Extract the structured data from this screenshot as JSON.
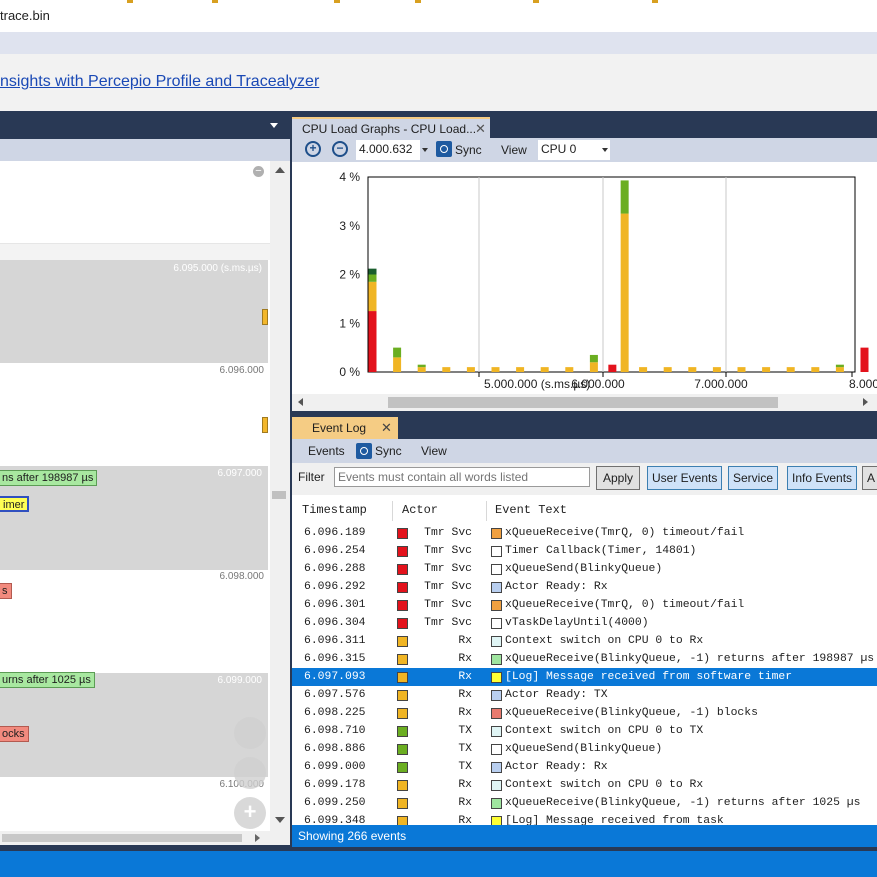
{
  "window": {
    "title": "trace.bin"
  },
  "banner": {
    "link_text": "nsights with Percepio Profile and Tracealyzer"
  },
  "left_panel": {
    "timeline": {
      "time_labels": [
        "6.095.000 (s.ms.µs)",
        "6.096.000",
        "6.097.000",
        "6.098.000",
        "6.099.000",
        "6.100.000"
      ],
      "events": [
        "ns after 198987 µs",
        "imer",
        "s",
        "urns after 1025 µs",
        "ocks"
      ]
    },
    "collapse_symbol": "−",
    "add_symbol": "+"
  },
  "cpu_panel": {
    "tab_label": "CPU Load Graphs - CPU Load...",
    "close_symbol": "✕",
    "zoom_in_symbol": "+",
    "zoom_out_symbol": "−",
    "zoom_value": "4.000.632",
    "sync_label": "Sync",
    "view_label": "View",
    "cpu_select": "CPU 0"
  },
  "chart_data": {
    "type": "bar",
    "stacked": true,
    "ylabel": "",
    "y_ticks": [
      "4 %",
      "3 %",
      "2 %",
      "1 %",
      "0 %"
    ],
    "ylim": [
      0,
      4
    ],
    "x_tick_labels": [
      "5.000.000 (s.ms.µs)",
      "6.000.000",
      "7.000.000",
      "8.000"
    ],
    "colors": {
      "red": "#e3121c",
      "orange": "#f0b524",
      "green": "#6bae21",
      "darkgreen": "#1a5e2d"
    },
    "bars": [
      {
        "index": 0,
        "segments": [
          {
            "color": "red",
            "value": 1.25
          },
          {
            "color": "orange",
            "value": 0.6
          },
          {
            "color": "green",
            "value": 0.15
          },
          {
            "color": "darkgreen",
            "value": 0.12
          }
        ]
      },
      {
        "index": 2,
        "segments": [
          {
            "color": "orange",
            "value": 0.3
          },
          {
            "color": "green",
            "value": 0.2
          }
        ]
      },
      {
        "index": 4,
        "segments": [
          {
            "color": "orange",
            "value": 0.1
          },
          {
            "color": "green",
            "value": 0.05
          }
        ]
      },
      {
        "index": 6,
        "segments": [
          {
            "color": "orange",
            "value": 0.1
          }
        ]
      },
      {
        "index": 8,
        "segments": [
          {
            "color": "orange",
            "value": 0.1
          }
        ]
      },
      {
        "index": 10,
        "segments": [
          {
            "color": "orange",
            "value": 0.1
          }
        ]
      },
      {
        "index": 12,
        "segments": [
          {
            "color": "orange",
            "value": 0.1
          }
        ]
      },
      {
        "index": 14,
        "segments": [
          {
            "color": "orange",
            "value": 0.1
          }
        ]
      },
      {
        "index": 16,
        "segments": [
          {
            "color": "orange",
            "value": 0.1
          }
        ]
      },
      {
        "index": 18,
        "segments": [
          {
            "color": "orange",
            "value": 0.2
          },
          {
            "color": "green",
            "value": 0.15
          }
        ]
      },
      {
        "index": 19.5,
        "segments": [
          {
            "color": "red",
            "value": 0.15
          }
        ]
      },
      {
        "index": 20.5,
        "segments": [
          {
            "color": "orange",
            "value": 3.25
          },
          {
            "color": "green",
            "value": 0.68
          }
        ]
      },
      {
        "index": 22,
        "segments": [
          {
            "color": "orange",
            "value": 0.1
          }
        ]
      },
      {
        "index": 24,
        "segments": [
          {
            "color": "orange",
            "value": 0.1
          }
        ]
      },
      {
        "index": 26,
        "segments": [
          {
            "color": "orange",
            "value": 0.1
          }
        ]
      },
      {
        "index": 28,
        "segments": [
          {
            "color": "orange",
            "value": 0.1
          }
        ]
      },
      {
        "index": 30,
        "segments": [
          {
            "color": "orange",
            "value": 0.1
          }
        ]
      },
      {
        "index": 32,
        "segments": [
          {
            "color": "orange",
            "value": 0.1
          }
        ]
      },
      {
        "index": 34,
        "segments": [
          {
            "color": "orange",
            "value": 0.1
          }
        ]
      },
      {
        "index": 36,
        "segments": [
          {
            "color": "orange",
            "value": 0.1
          }
        ]
      },
      {
        "index": 38,
        "segments": [
          {
            "color": "orange",
            "value": 0.1
          },
          {
            "color": "green",
            "value": 0.05
          }
        ]
      },
      {
        "index": 40,
        "segments": [
          {
            "color": "red",
            "value": 0.5
          }
        ]
      }
    ]
  },
  "event_log": {
    "tab_label": "Event Log",
    "close_symbol": "✕",
    "toolbar": {
      "events": "Events",
      "sync": "Sync",
      "view": "View"
    },
    "filter_label": "Filter",
    "filter_placeholder": "Events must contain all words listed",
    "buttons": {
      "apply": "Apply",
      "user_events": "User Events",
      "service": "Service",
      "info_events": "Info Events",
      "more": "A"
    },
    "columns": {
      "timestamp": "Timestamp",
      "actor": "Actor",
      "event_text": "Event Text"
    },
    "actor_colors": {
      "Tmr Svc": "#e3121c",
      "Rx": "#f0b524",
      "TX": "#6bae21"
    },
    "rows": [
      {
        "ts": "6.096.189",
        "actor": "Tmr Svc",
        "ecolor": "#f0a040",
        "text": "xQueueReceive(TmrQ, 0) timeout/fail"
      },
      {
        "ts": "6.096.254",
        "actor": "Tmr Svc",
        "ecolor": "#ffffff",
        "text": "Timer Callback(Timer, 14801)"
      },
      {
        "ts": "6.096.288",
        "actor": "Tmr Svc",
        "ecolor": "#ffffff",
        "text": "xQueueSend(BlinkyQueue)"
      },
      {
        "ts": "6.096.292",
        "actor": "Tmr Svc",
        "ecolor": "#b9cff0",
        "text": "Actor Ready: Rx"
      },
      {
        "ts": "6.096.301",
        "actor": "Tmr Svc",
        "ecolor": "#f0a040",
        "text": "xQueueReceive(TmrQ, 0) timeout/fail"
      },
      {
        "ts": "6.096.304",
        "actor": "Tmr Svc",
        "ecolor": "#ffffff",
        "text": "vTaskDelayUntil(4000)"
      },
      {
        "ts": "6.096.311",
        "actor": "Rx",
        "ecolor": "#e0f5f5",
        "text": "Context switch on CPU 0 to Rx"
      },
      {
        "ts": "6.096.315",
        "actor": "Rx",
        "ecolor": "#9fe59f",
        "text": "xQueueReceive(BlinkyQueue, -1) returns after 198987 µs"
      },
      {
        "ts": "6.097.093",
        "actor": "Rx",
        "ecolor": "#ffff33",
        "text": "[Log] Message received from software timer",
        "selected": true
      },
      {
        "ts": "6.097.576",
        "actor": "Rx",
        "ecolor": "#b9cff0",
        "text": "Actor Ready: TX"
      },
      {
        "ts": "6.098.225",
        "actor": "Rx",
        "ecolor": "#e87a6e",
        "text": "xQueueReceive(BlinkyQueue, -1) blocks"
      },
      {
        "ts": "6.098.710",
        "actor": "TX",
        "ecolor": "#e0f5f5",
        "text": "Context switch on CPU 0 to TX"
      },
      {
        "ts": "6.098.886",
        "actor": "TX",
        "ecolor": "#ffffff",
        "text": "xQueueSend(BlinkyQueue)"
      },
      {
        "ts": "6.099.000",
        "actor": "TX",
        "ecolor": "#b9cff0",
        "text": "Actor Ready: Rx"
      },
      {
        "ts": "6.099.178",
        "actor": "Rx",
        "ecolor": "#e0f5f5",
        "text": "Context switch on CPU 0 to Rx"
      },
      {
        "ts": "6.099.250",
        "actor": "Rx",
        "ecolor": "#9fe59f",
        "text": "xQueueReceive(BlinkyQueue, -1) returns after 1025 µs"
      },
      {
        "ts": "6.099.348",
        "actor": "Rx",
        "ecolor": "#ffff33",
        "text": "[Log] Message received from task"
      }
    ],
    "status": "Showing 266 events"
  }
}
